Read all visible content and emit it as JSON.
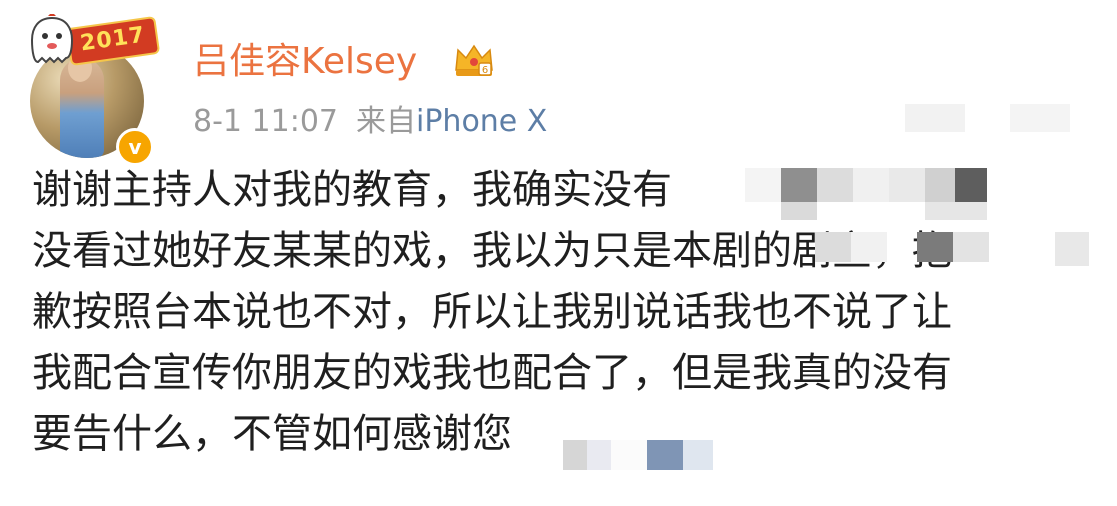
{
  "header": {
    "username": "吕佳容Kelsey",
    "timestamp": "8-1 11:07",
    "source_prefix": "来自",
    "device": "iPhone X",
    "avatar_badge_text": "2017",
    "verified_icon": "v-verified-icon",
    "member_icon": "crown-icon"
  },
  "post": {
    "lines": [
      "谢谢主持人对我的教育，我确实没有",
      "没看过她好友某某的戏，我以为只是本剧的剧宣，抱",
      "歉按照台本说也不对，所以让我别说话我也不说了让",
      "我配合宣传你朋友的戏我也配合了，但是我真的没有",
      "要告什么，不管如何感谢您"
    ]
  },
  "colors": {
    "username": "#eb7340",
    "meta": "#9a9a9a",
    "device_link": "#5d7ea6",
    "body": "#1f1f1f",
    "verified": "#f7a500"
  }
}
